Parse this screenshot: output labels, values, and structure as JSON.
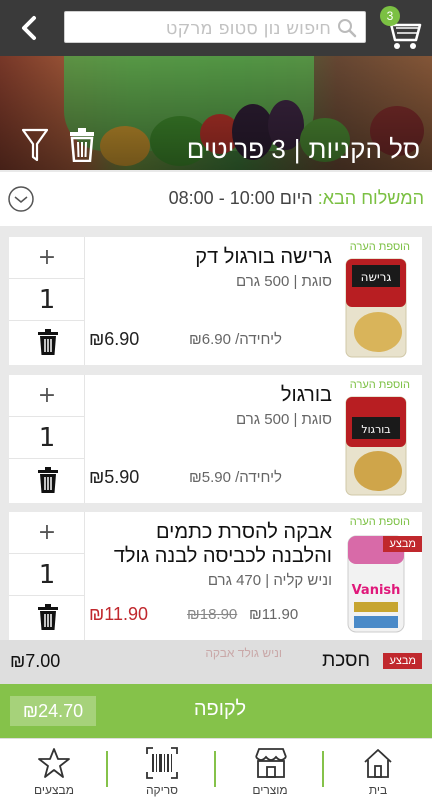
{
  "header": {
    "search_placeholder": "חיפוש נון סטופ מרקט",
    "cart_count": "3"
  },
  "banner": {
    "title": "סל הקניות",
    "separator": "|",
    "items_count": "3 פריטים"
  },
  "delivery": {
    "label": "המשלוח הבא:",
    "value": "היום 10:00 - 08:00"
  },
  "products": [
    {
      "note": "הוספת הערה",
      "name": "גרישה בורגול דק",
      "sub": "סוגת | 500 גרם",
      "qty": "1",
      "plus": "+",
      "unit_price": "₪6.90 /ליחידה",
      "total": "₪6.90",
      "package_text": "גרישה"
    },
    {
      "note": "הוספת הערה",
      "name": "בורגול",
      "sub": "סוגת | 500 גרם",
      "qty": "1",
      "plus": "+",
      "unit_price": "₪5.90 /ליחידה",
      "total": "₪5.90",
      "package_text": "בורגול"
    },
    {
      "note": "הוספת הערה",
      "name": "אבקה להסרת כתמים והלבנה לכביסה לבנה גולד",
      "sub": "וניש קליה | 470 גרם",
      "qty": "1",
      "plus": "+",
      "promo": "מבצע",
      "unit_price": "₪11.90",
      "old_price": "₪18.90",
      "total": "₪11.90",
      "package_text": "Vanish"
    }
  ],
  "savings": {
    "tag": "מבצע",
    "label": "חסכת",
    "amount": "₪7.00",
    "ghost_text": "וניש גולד אבקה"
  },
  "checkout": {
    "label": "לקופה",
    "total": "₪24.70"
  },
  "bottom_nav": [
    {
      "label": "בית",
      "icon": "home-icon"
    },
    {
      "label": "מוצרים",
      "icon": "store-icon"
    },
    {
      "label": "סריקה",
      "icon": "barcode-icon"
    },
    {
      "label": "מבצעים",
      "icon": "star-icon"
    }
  ],
  "colors": {
    "green": "#85c24a",
    "promo_red": "#c0282d",
    "topbar": "#3a3a3a"
  }
}
